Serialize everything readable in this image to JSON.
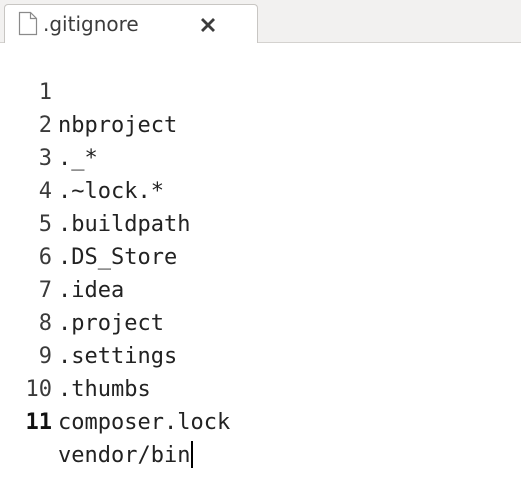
{
  "tab": {
    "title": ".gitignore",
    "file_icon": "file-icon",
    "close_icon": "close-icon"
  },
  "editor": {
    "current_line": 11,
    "lines": [
      {
        "number": "1",
        "text": "nbproject"
      },
      {
        "number": "2",
        "text": "._*"
      },
      {
        "number": "3",
        "text": ".~lock.*"
      },
      {
        "number": "4",
        "text": ".buildpath"
      },
      {
        "number": "5",
        "text": ".DS_Store"
      },
      {
        "number": "6",
        "text": ".idea"
      },
      {
        "number": "7",
        "text": ".project"
      },
      {
        "number": "8",
        "text": ".settings"
      },
      {
        "number": "9",
        "text": ".thumbs"
      },
      {
        "number": "10",
        "text": "composer.lock"
      },
      {
        "number": "11",
        "text": "vendor/bin"
      }
    ]
  }
}
